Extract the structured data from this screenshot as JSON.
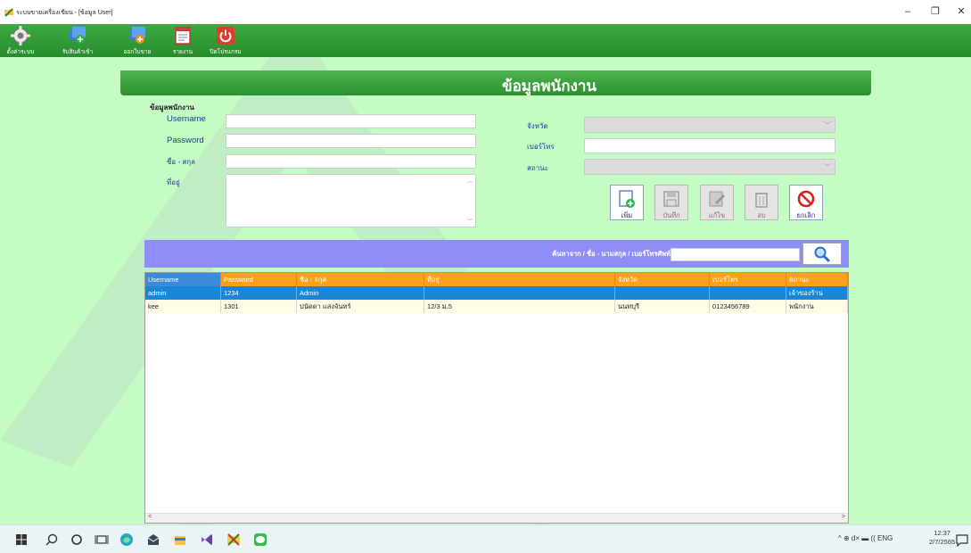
{
  "window": {
    "title": "ระบบขายเครื่องเขียน - [ข้อมูล User]",
    "controls": {
      "minimize": "–",
      "maximize": "❐",
      "close": "✕"
    }
  },
  "toolbar": [
    {
      "label": "ตั้งค่าระบบ",
      "icon": "gear-icon"
    },
    {
      "label": "รับสินค้าเข้า",
      "icon": "receive-goods-icon"
    },
    {
      "label": "ออกใบขาย",
      "icon": "invoice-icon"
    },
    {
      "label": "รายงาน",
      "icon": "report-icon"
    },
    {
      "label": "ปิดโปรแกรม",
      "icon": "power-icon"
    }
  ],
  "page": {
    "title": "ข้อมูลพนักงาน"
  },
  "form": {
    "heading": "ข้อมูลพนักงาน",
    "username_label": "Username",
    "username_value": "",
    "password_label": "Password",
    "password_value": "",
    "fullname_label": "ชื่อ - สกุล",
    "fullname_value": "",
    "address_label": "ที่อยู่",
    "address_value": "",
    "province_label": "จังหวัด",
    "province_value": "",
    "phone_label": "เบอร์โทร",
    "phone_value": "",
    "status_label": "สถานะ",
    "status_value": ""
  },
  "actions": {
    "add": "เพิ่ม",
    "save": "บันทึก",
    "edit": "แก้ไข",
    "delete": "ลบ",
    "cancel": "ยกเลิก"
  },
  "search": {
    "label": "ค้นหาจาก / ชื่อ - นามสกุล / เบอร์โทรศัพท์",
    "value": ""
  },
  "grid": {
    "columns": [
      "Username",
      "Password",
      "ชื่อ - สกุล",
      "ที่อยู่",
      "จังหวัด",
      "เบอร์โทร",
      "สถานะ"
    ],
    "rows": [
      [
        "admin",
        "1234",
        "Admin",
        "",
        "",
        "",
        "เจ้าของร้าน"
      ],
      [
        "kee",
        "1301",
        "ปนัดดา แสงจันทร์",
        "12/3 ม.5",
        "นนทบุรี",
        "0123456789",
        "พนักงาน"
      ]
    ],
    "selected_row": 0
  },
  "taskbar": {
    "tray_text": "^  ⊕  d×  ▬  ((  ENG",
    "time": "12:37",
    "date": "2/7/2565"
  },
  "colors": {
    "toolbar_green": "#2f9a33",
    "background_green": "#c5fcc3",
    "search_band": "#8f8df8",
    "grid_header": "#fda018",
    "selected_row": "#1b86d7"
  }
}
